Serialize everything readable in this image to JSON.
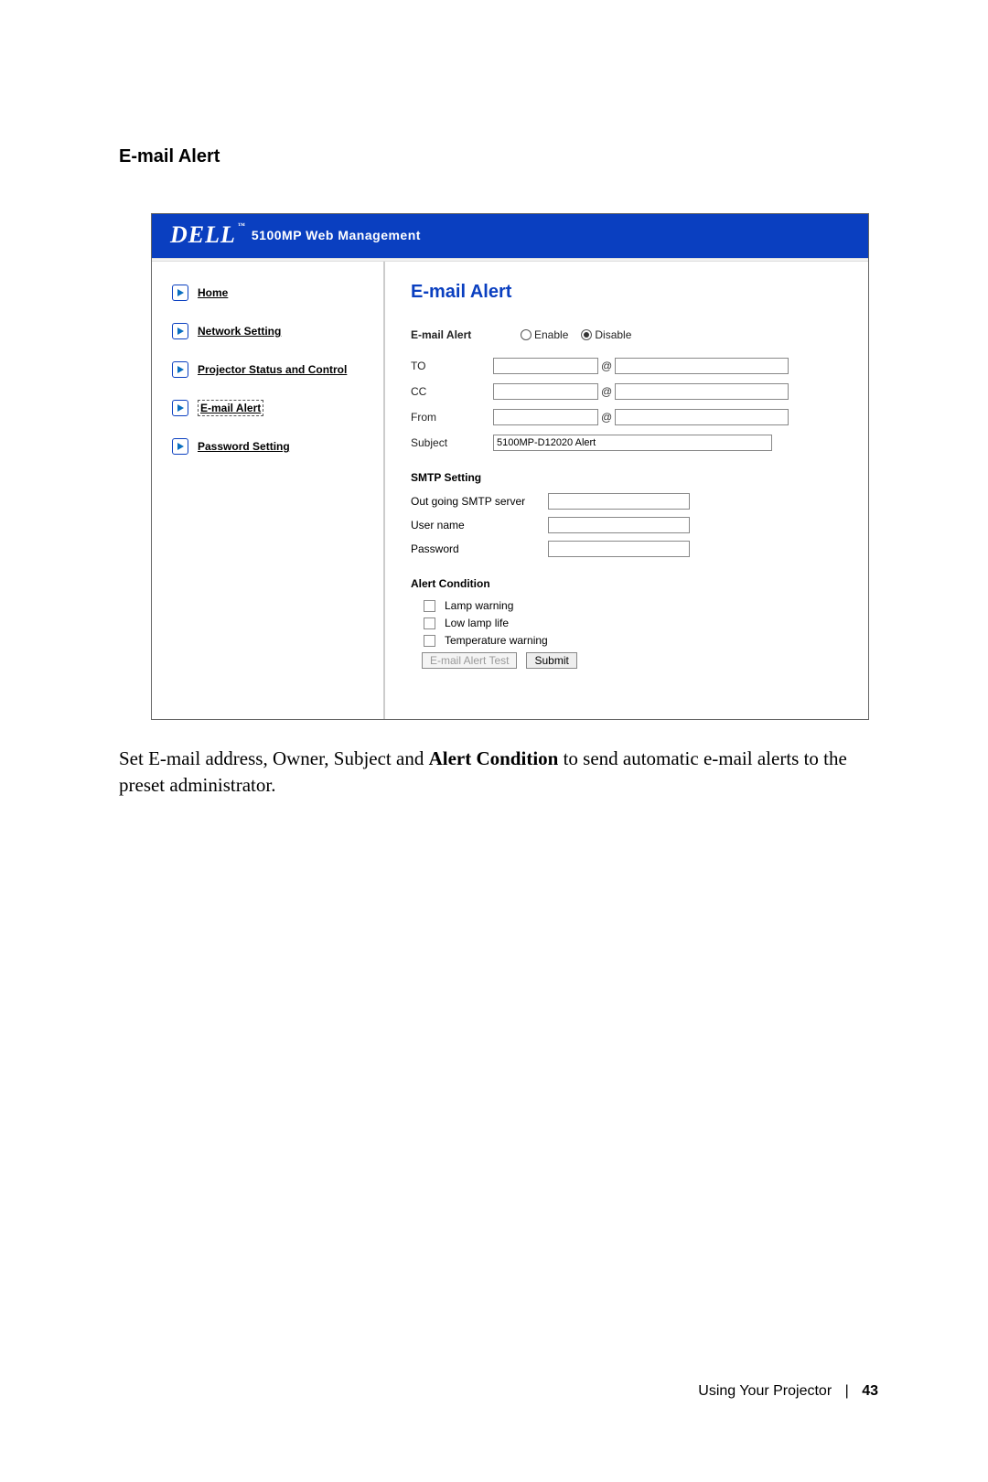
{
  "section_title": "E-mail Alert",
  "banner": {
    "logo": "DELL",
    "subtitle": "5100MP Web Management"
  },
  "sidebar": {
    "items": [
      {
        "label": "Home"
      },
      {
        "label": "Network Setting"
      },
      {
        "label": "Projector Status and Control"
      },
      {
        "label": "E-mail Alert"
      },
      {
        "label": "Password Setting"
      }
    ]
  },
  "main": {
    "title": "E-mail Alert",
    "email_alert_label": "E-mail Alert",
    "enable_label": "Enable",
    "disable_label": "Disable",
    "to_label": "TO",
    "cc_label": "CC",
    "from_label": "From",
    "subject_label": "Subject",
    "subject_value": "5100MP-D12020 Alert",
    "at_symbol": "@",
    "smtp_heading": "SMTP Setting",
    "smtp_server_label": "Out going SMTP server",
    "user_name_label": "User name",
    "password_label": "Password",
    "alert_heading": "Alert Condition",
    "cond1": "Lamp warning",
    "cond2": "Low lamp life",
    "cond3": "Temperature warning",
    "btn_test": "E-mail Alert Test",
    "btn_submit": "Submit"
  },
  "caption_1": "Set E-mail address, Owner, Subject and ",
  "caption_bold": "Alert Condition",
  "caption_2": " to send automatic e-mail alerts to the preset administrator.",
  "footer": {
    "text": "Using Your Projector",
    "page": "43"
  }
}
